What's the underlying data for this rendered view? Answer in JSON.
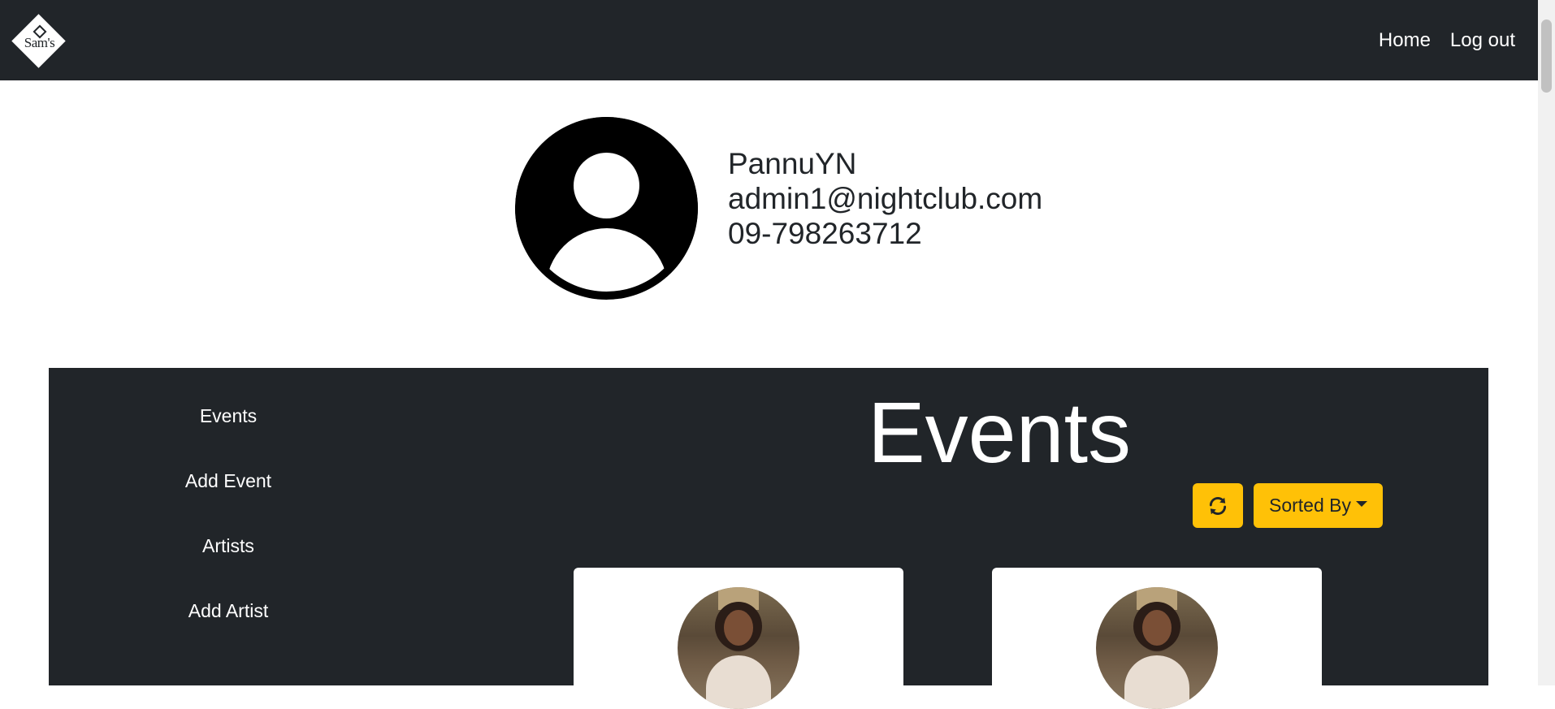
{
  "nav": {
    "logo_text": "Sam's",
    "links": [
      "Home",
      "Log out"
    ]
  },
  "profile": {
    "username": "PannuYN",
    "email": "admin1@nightclub.com",
    "phone": "09-798263712"
  },
  "sidebar": {
    "items": [
      {
        "label": "Events"
      },
      {
        "label": "Add Event"
      },
      {
        "label": "Artists"
      },
      {
        "label": "Add Artist"
      }
    ]
  },
  "main": {
    "title": "Events",
    "sort_label": "Sorted By",
    "refresh_icon": "refresh-icon"
  },
  "colors": {
    "navbar": "#212529",
    "accent": "#ffc107",
    "panel": "#212529"
  }
}
